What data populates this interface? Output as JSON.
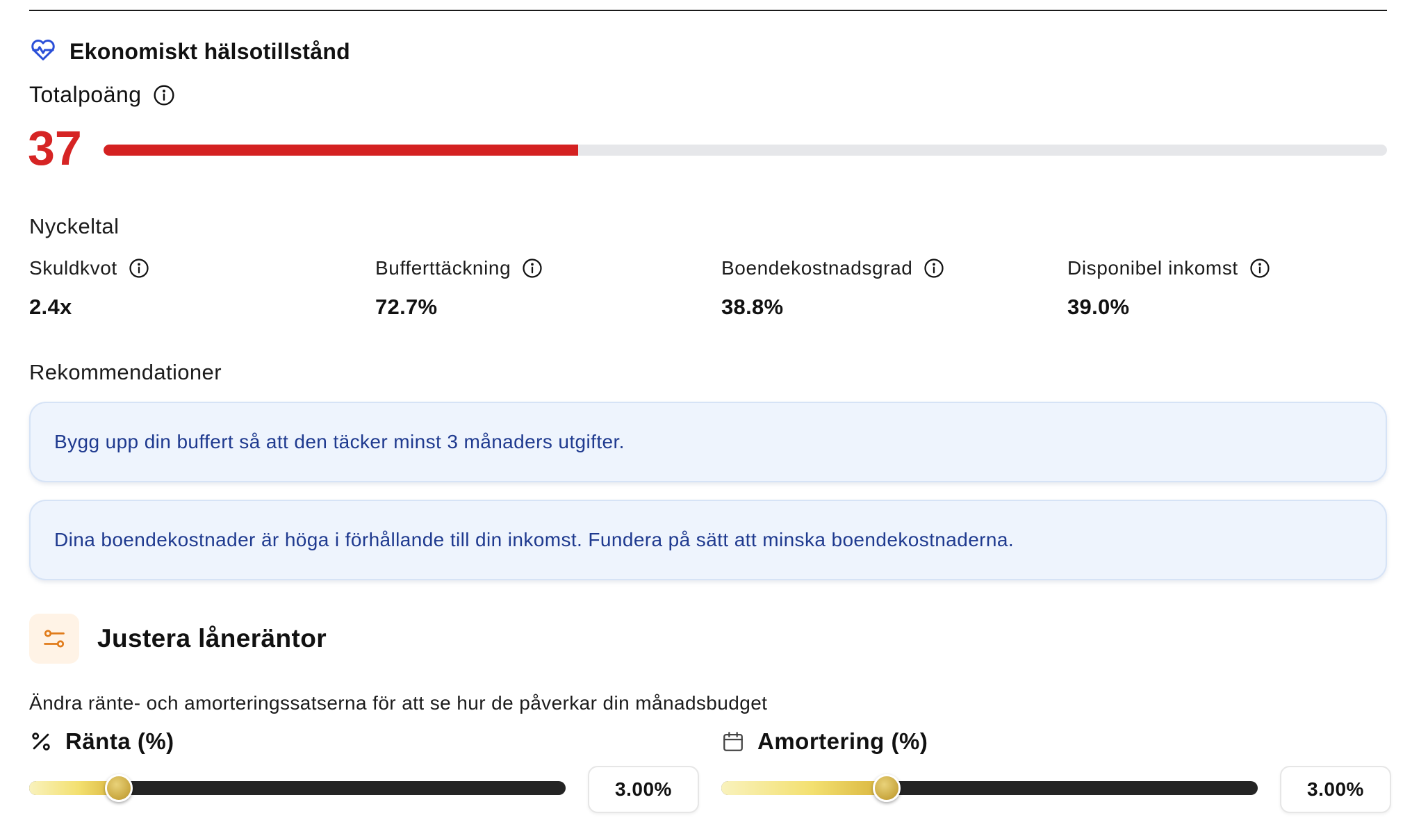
{
  "health": {
    "title": "Ekonomiskt hälsotillstånd",
    "total_label": "Totalpoäng",
    "score": "37",
    "score_fraction": 0.37,
    "score_color": "#d62424"
  },
  "metrics": {
    "heading": "Nyckeltal",
    "items": [
      {
        "label": "Skuldkvot",
        "value": "2.4x"
      },
      {
        "label": "Bufferttäckning",
        "value": "72.7%"
      },
      {
        "label": "Boendekostnadsgrad",
        "value": "38.8%"
      },
      {
        "label": "Disponibel inkomst",
        "value": "39.0%"
      }
    ]
  },
  "recommendations": {
    "heading": "Rekommendationer",
    "items": [
      "Bygg upp din buffert så att den täcker minst 3 månaders utgifter.",
      "Dina boendekostnader är höga i förhållande till din inkomst. Fundera på sätt att minska boendekostnaderna."
    ]
  },
  "adjust": {
    "title": "Justera låneräntor",
    "description": "Ändra ränte- och amorteringssatserna för att se hur de påverkar din månadsbudget",
    "interest": {
      "label": "Ränta (%)",
      "value": "3.00%",
      "slider_fraction": 0.167,
      "icon": "percent-icon"
    },
    "amortization": {
      "label": "Amortering (%)",
      "value": "3.00%",
      "slider_fraction": 0.308,
      "icon": "calendar-icon"
    }
  },
  "icons": {
    "health": "heart-pulse-icon",
    "info": "info-icon",
    "adjust": "sliders-icon"
  },
  "colors": {
    "accent_red": "#d42121",
    "heart_blue": "#2a4fd8",
    "recommendation_bg": "#eef4fd",
    "recommendation_text": "#1f3a8f",
    "adjust_icon_color": "#e07b1a",
    "slider_gold": "#c8a63e"
  }
}
